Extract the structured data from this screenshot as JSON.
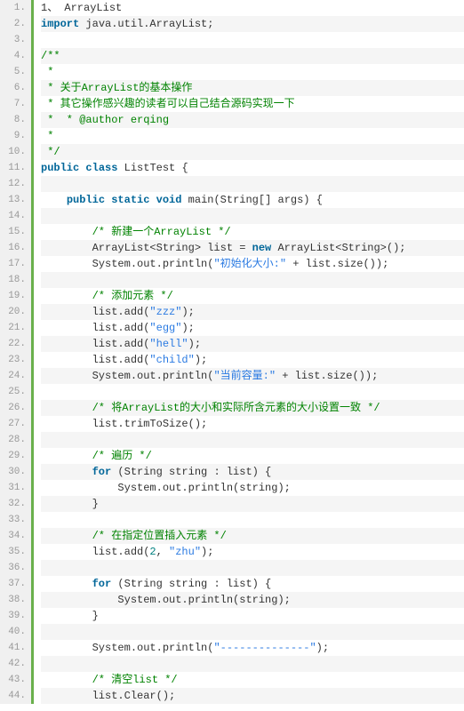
{
  "lines": [
    {
      "n": "1.",
      "tokens": [
        {
          "t": "1",
          "cls": "plain"
        },
        {
          "t": "、 ArrayList",
          "cls": "plain"
        }
      ]
    },
    {
      "n": "2.",
      "tokens": [
        {
          "t": "import",
          "cls": "keyword"
        },
        {
          "t": " java.util.ArrayList;",
          "cls": "plain"
        }
      ]
    },
    {
      "n": "3.",
      "tokens": []
    },
    {
      "n": "4.",
      "tokens": [
        {
          "t": "/**",
          "cls": "comment"
        }
      ]
    },
    {
      "n": "5.",
      "tokens": [
        {
          "t": " *",
          "cls": "comment"
        }
      ]
    },
    {
      "n": "6.",
      "tokens": [
        {
          "t": " * 关于ArrayList的基本操作",
          "cls": "comment"
        }
      ]
    },
    {
      "n": "7.",
      "tokens": [
        {
          "t": " * 其它操作感兴趣的读者可以自己结合源码实现一下",
          "cls": "comment"
        }
      ]
    },
    {
      "n": "8.",
      "tokens": [
        {
          "t": " *  * @author erqing",
          "cls": "comment"
        }
      ]
    },
    {
      "n": "9.",
      "tokens": [
        {
          "t": " *",
          "cls": "comment"
        }
      ]
    },
    {
      "n": "10.",
      "tokens": [
        {
          "t": " */",
          "cls": "comment"
        }
      ]
    },
    {
      "n": "11.",
      "tokens": [
        {
          "t": "public",
          "cls": "keyword"
        },
        {
          "t": " ",
          "cls": "plain"
        },
        {
          "t": "class",
          "cls": "keyword"
        },
        {
          "t": " ListTest {",
          "cls": "plain"
        }
      ]
    },
    {
      "n": "12.",
      "tokens": []
    },
    {
      "n": "13.",
      "tokens": [
        {
          "t": "    ",
          "cls": "plain"
        },
        {
          "t": "public",
          "cls": "keyword"
        },
        {
          "t": " ",
          "cls": "plain"
        },
        {
          "t": "static",
          "cls": "keyword"
        },
        {
          "t": " ",
          "cls": "plain"
        },
        {
          "t": "void",
          "cls": "keyword"
        },
        {
          "t": " main(String[] args) {",
          "cls": "plain"
        }
      ]
    },
    {
      "n": "14.",
      "tokens": []
    },
    {
      "n": "15.",
      "tokens": [
        {
          "t": "        ",
          "cls": "plain"
        },
        {
          "t": "/* 新建一个ArrayList */",
          "cls": "comment"
        }
      ]
    },
    {
      "n": "16.",
      "tokens": [
        {
          "t": "        ArrayList<String> list = ",
          "cls": "plain"
        },
        {
          "t": "new",
          "cls": "keyword"
        },
        {
          "t": " ArrayList<String>();",
          "cls": "plain"
        }
      ]
    },
    {
      "n": "17.",
      "tokens": [
        {
          "t": "        System.out.println(",
          "cls": "plain"
        },
        {
          "t": "\"初始化大小:\"",
          "cls": "string"
        },
        {
          "t": " + list.size());",
          "cls": "plain"
        }
      ]
    },
    {
      "n": "18.",
      "tokens": []
    },
    {
      "n": "19.",
      "tokens": [
        {
          "t": "        ",
          "cls": "plain"
        },
        {
          "t": "/* 添加元素 */",
          "cls": "comment"
        }
      ]
    },
    {
      "n": "20.",
      "tokens": [
        {
          "t": "        list.add(",
          "cls": "plain"
        },
        {
          "t": "\"zzz\"",
          "cls": "string"
        },
        {
          "t": ");",
          "cls": "plain"
        }
      ]
    },
    {
      "n": "21.",
      "tokens": [
        {
          "t": "        list.add(",
          "cls": "plain"
        },
        {
          "t": "\"egg\"",
          "cls": "string"
        },
        {
          "t": ");",
          "cls": "plain"
        }
      ]
    },
    {
      "n": "22.",
      "tokens": [
        {
          "t": "        list.add(",
          "cls": "plain"
        },
        {
          "t": "\"hell\"",
          "cls": "string"
        },
        {
          "t": ");",
          "cls": "plain"
        }
      ]
    },
    {
      "n": "23.",
      "tokens": [
        {
          "t": "        list.add(",
          "cls": "plain"
        },
        {
          "t": "\"child\"",
          "cls": "string"
        },
        {
          "t": ");",
          "cls": "plain"
        }
      ]
    },
    {
      "n": "24.",
      "tokens": [
        {
          "t": "        System.out.println(",
          "cls": "plain"
        },
        {
          "t": "\"当前容量:\"",
          "cls": "string"
        },
        {
          "t": " + list.size());",
          "cls": "plain"
        }
      ]
    },
    {
      "n": "25.",
      "tokens": []
    },
    {
      "n": "26.",
      "tokens": [
        {
          "t": "        ",
          "cls": "plain"
        },
        {
          "t": "/* 将ArrayList的大小和实际所含元素的大小设置一致 */",
          "cls": "comment"
        }
      ]
    },
    {
      "n": "27.",
      "tokens": [
        {
          "t": "        list.trimToSize();",
          "cls": "plain"
        }
      ]
    },
    {
      "n": "28.",
      "tokens": []
    },
    {
      "n": "29.",
      "tokens": [
        {
          "t": "        ",
          "cls": "plain"
        },
        {
          "t": "/* 遍历 */",
          "cls": "comment"
        }
      ]
    },
    {
      "n": "30.",
      "tokens": [
        {
          "t": "        ",
          "cls": "plain"
        },
        {
          "t": "for",
          "cls": "keyword"
        },
        {
          "t": " (String string : list) {",
          "cls": "plain"
        }
      ]
    },
    {
      "n": "31.",
      "tokens": [
        {
          "t": "            System.out.println(string);",
          "cls": "plain"
        }
      ]
    },
    {
      "n": "32.",
      "tokens": [
        {
          "t": "        }",
          "cls": "plain"
        }
      ]
    },
    {
      "n": "33.",
      "tokens": []
    },
    {
      "n": "34.",
      "tokens": [
        {
          "t": "        ",
          "cls": "plain"
        },
        {
          "t": "/* 在指定位置插入元素 */",
          "cls": "comment"
        }
      ]
    },
    {
      "n": "35.",
      "tokens": [
        {
          "t": "        list.add(",
          "cls": "plain"
        },
        {
          "t": "2",
          "cls": "number"
        },
        {
          "t": ", ",
          "cls": "plain"
        },
        {
          "t": "\"zhu\"",
          "cls": "string"
        },
        {
          "t": ");",
          "cls": "plain"
        }
      ]
    },
    {
      "n": "36.",
      "tokens": []
    },
    {
      "n": "37.",
      "tokens": [
        {
          "t": "        ",
          "cls": "plain"
        },
        {
          "t": "for",
          "cls": "keyword"
        },
        {
          "t": " (String string : list) {",
          "cls": "plain"
        }
      ]
    },
    {
      "n": "38.",
      "tokens": [
        {
          "t": "            System.out.println(string);",
          "cls": "plain"
        }
      ]
    },
    {
      "n": "39.",
      "tokens": [
        {
          "t": "        }",
          "cls": "plain"
        }
      ]
    },
    {
      "n": "40.",
      "tokens": []
    },
    {
      "n": "41.",
      "tokens": [
        {
          "t": "        System.out.println(",
          "cls": "plain"
        },
        {
          "t": "\"--------------\"",
          "cls": "string"
        },
        {
          "t": ");",
          "cls": "plain"
        }
      ]
    },
    {
      "n": "42.",
      "tokens": []
    },
    {
      "n": "43.",
      "tokens": [
        {
          "t": "        ",
          "cls": "plain"
        },
        {
          "t": "/* 清空list */",
          "cls": "comment"
        }
      ]
    },
    {
      "n": "44.",
      "tokens": [
        {
          "t": "        list.Clear();",
          "cls": "plain"
        }
      ]
    }
  ]
}
